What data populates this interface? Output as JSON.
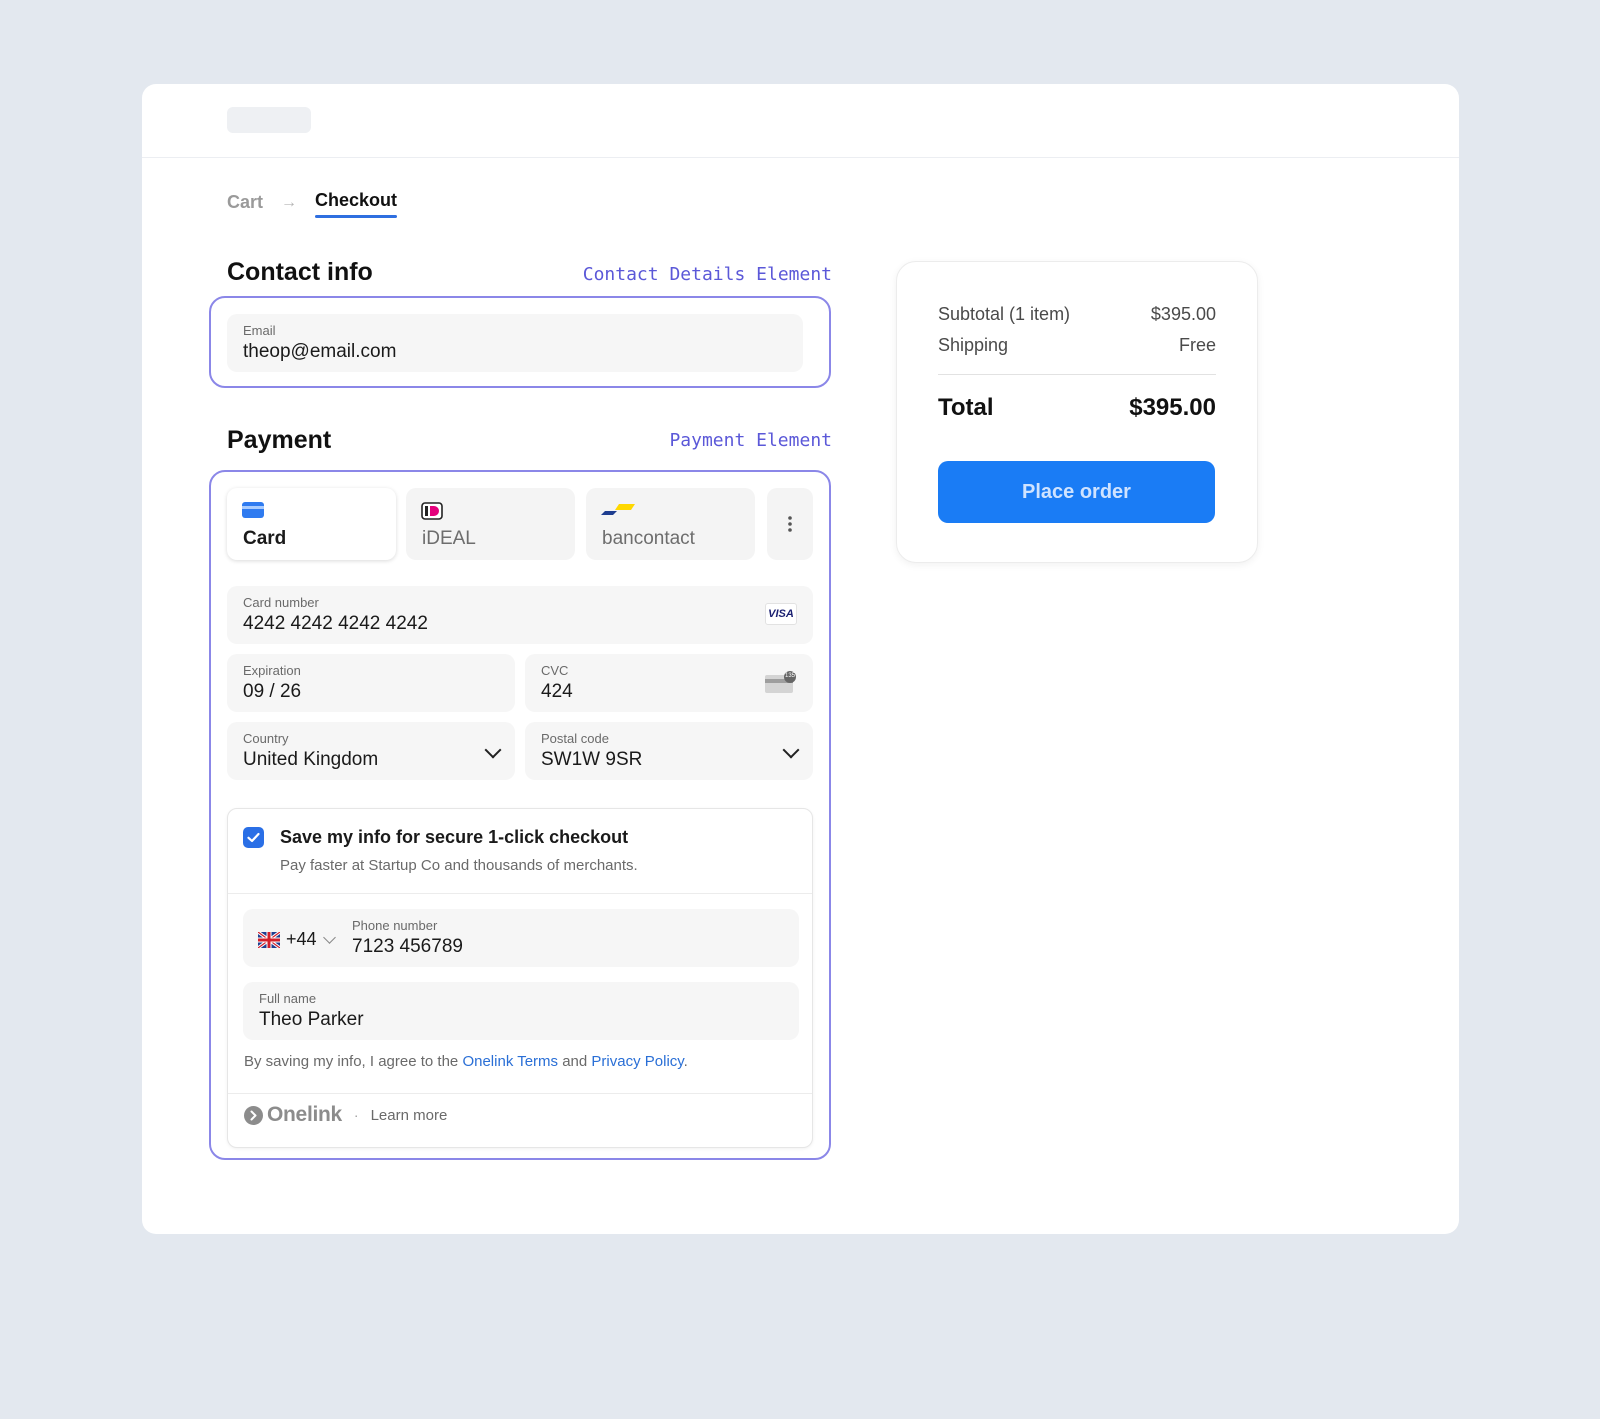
{
  "breadcrumb": {
    "cart": "Cart",
    "arrow": "→",
    "checkout": "Checkout"
  },
  "contact": {
    "title": "Contact info",
    "element_tag": "Contact Details Element",
    "email_label": "Email",
    "email_value": "theop@email.com"
  },
  "payment": {
    "title": "Payment",
    "element_tag": "Payment Element",
    "tabs": [
      {
        "label": "Card",
        "icon": "card-icon",
        "active": true
      },
      {
        "label": "iDEAL",
        "icon": "ideal-icon",
        "active": false
      },
      {
        "label": "bancontact",
        "icon": "bancontact-icon",
        "active": false
      }
    ],
    "more_icon": "more-vertical-icon",
    "card_number_label": "Card number",
    "card_number_value": "4242 4242 4242 4242",
    "card_brand": "VISA",
    "expiration_label": "Expiration",
    "expiration_value": "09 / 26",
    "cvc_label": "CVC",
    "cvc_value": "424",
    "cvc_icon_text": "135",
    "country_label": "Country",
    "country_value": "United Kingdom",
    "postal_label": "Postal code",
    "postal_value": "SW1W 9SR"
  },
  "save_info": {
    "title": "Save my info for secure 1-click checkout",
    "subtitle": "Pay faster at Startup Co and thousands of merchants.",
    "checked": true,
    "phone_code": "+44",
    "phone_label": "Phone number",
    "phone_value": "7123 456789",
    "name_label": "Full name",
    "name_value": "Theo Parker",
    "agree_prefix": "By saving my info, I agree to the ",
    "terms_link": "Onelink Terms",
    "agree_and": " and ",
    "privacy_link": "Privacy Policy",
    "agree_suffix": ".",
    "brand": "Onelink",
    "separator": "·",
    "learn_more": "Learn more"
  },
  "summary": {
    "subtotal_label": "Subtotal (1 item)",
    "subtotal_value": "$395.00",
    "shipping_label": "Shipping",
    "shipping_value": "Free",
    "total_label": "Total",
    "total_value": "$395.00",
    "place_order": "Place order"
  },
  "colors": {
    "accent": "#1a7cf5",
    "element_outline": "#8b87e8",
    "element_tag": "#5b58d8",
    "link": "#2a6fd6"
  }
}
